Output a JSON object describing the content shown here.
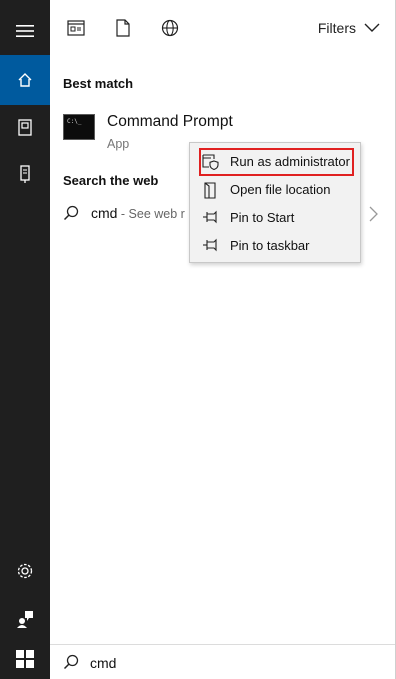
{
  "rail": {
    "items": [
      {
        "icon": "hamburger-menu-icon"
      },
      {
        "icon": "home-icon",
        "active": true
      },
      {
        "icon": "documents-icon"
      },
      {
        "icon": "device-icon"
      },
      {
        "icon": "settings-gear-icon"
      },
      {
        "icon": "user-feedback-icon"
      }
    ]
  },
  "topbar": {
    "icons": [
      "apps-icon",
      "document-icon",
      "web-globe-icon"
    ],
    "filters_label": "Filters"
  },
  "best_match": {
    "section_title": "Best match",
    "app_name": "Command Prompt",
    "app_type": "App",
    "app_icon_text": "C:\\_"
  },
  "web": {
    "section_title": "Search the web",
    "query": "cmd",
    "hint": " - See web r"
  },
  "context_menu": {
    "items": [
      {
        "label": "Run as administrator",
        "icon": "shield-run-icon"
      },
      {
        "label": "Open file location",
        "icon": "file-location-icon"
      },
      {
        "label": "Pin to Start",
        "icon": "pin-icon"
      },
      {
        "label": "Pin to taskbar",
        "icon": "pin-icon"
      }
    ],
    "highlighted": "Run as administrator",
    "highlight_color": "#e02020"
  },
  "search": {
    "value": "cmd"
  },
  "colors": {
    "rail": "#1f1f1f",
    "accent": "#005a9e"
  }
}
